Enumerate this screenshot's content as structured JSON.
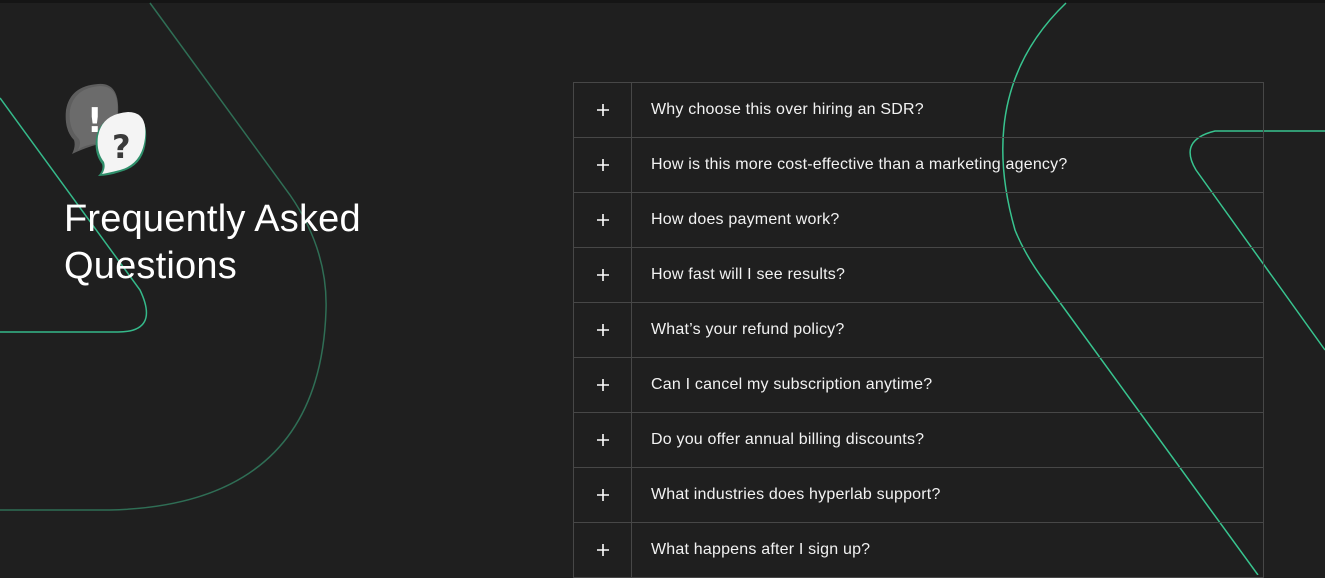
{
  "section": {
    "title": "Frequently Asked Questions",
    "icon": "question-exclamation-bubbles-icon",
    "accent_color": "#4fd1a5"
  },
  "faq": {
    "toggle_icon": "plus-icon",
    "items": [
      {
        "question": "Why choose this over hiring an SDR?"
      },
      {
        "question": "How is this more cost-effective than a marketing agency?"
      },
      {
        "question": "How does payment work?"
      },
      {
        "question": "How fast will I see results?"
      },
      {
        "question": "What’s your refund policy?"
      },
      {
        "question": "Can I cancel my subscription anytime?"
      },
      {
        "question": "Do you offer annual billing discounts?"
      },
      {
        "question": "What industries does hyperlab support?"
      },
      {
        "question": "What happens after I sign up?"
      }
    ]
  }
}
